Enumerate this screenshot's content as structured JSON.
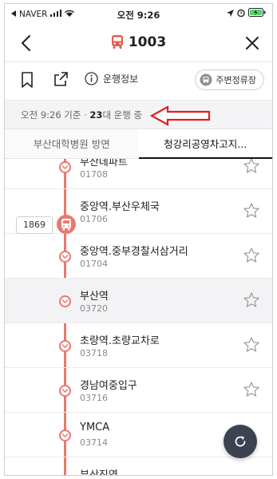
{
  "status_bar": {
    "carrier": "NAVER",
    "time": "오전 9:26"
  },
  "nav": {
    "route_number": "1003"
  },
  "toolbar": {
    "info_label": "운행정보",
    "nearby_stops_label": "주변정류장"
  },
  "status": {
    "prefix": "오전 9:26 기준 · ",
    "count": "23",
    "suffix": "대 운행 중"
  },
  "tabs": [
    {
      "label": "부산대학병원 방면",
      "active": false
    },
    {
      "label": "청강리공영차고지...",
      "active": true
    }
  ],
  "stops": [
    {
      "name": "부산데파트",
      "code": "01708",
      "highlighted": false
    },
    {
      "name": "중앙역.부산우체국",
      "code": "01706",
      "highlighted": false
    },
    {
      "name": "중앙역.중부경찰서삼거리",
      "code": "01704",
      "highlighted": false
    },
    {
      "name": "부산역",
      "code": "03720",
      "highlighted": true
    },
    {
      "name": "초량역.초량교차로",
      "code": "03718",
      "highlighted": false
    },
    {
      "name": "경남여중입구",
      "code": "03716",
      "highlighted": false
    },
    {
      "name": "YMCA",
      "code": "03714",
      "highlighted": false
    },
    {
      "name": "부산진역",
      "code": "",
      "highlighted": false
    }
  ],
  "bus": {
    "vehicle_number": "1869"
  },
  "colors": {
    "route": "#e8796d",
    "fab": "#3b4350",
    "annotation_arrow": "#e02020"
  }
}
